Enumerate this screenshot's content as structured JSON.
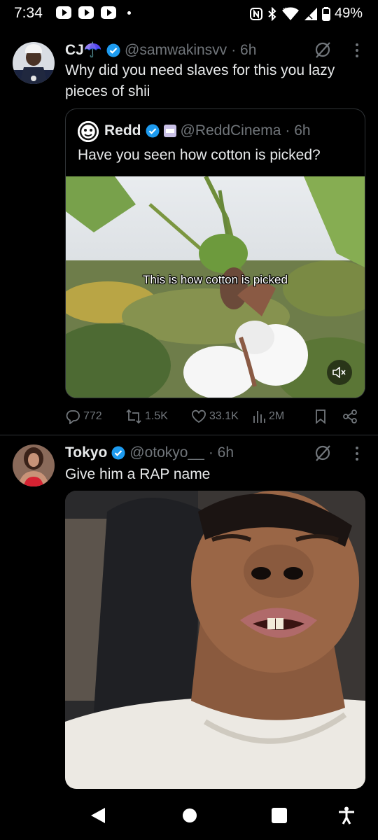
{
  "status_bar": {
    "time": "7:34",
    "battery": "49%",
    "notification_icons": [
      "youtube-icon",
      "youtube-icon",
      "youtube-icon"
    ],
    "system_icons": [
      "nfc-icon",
      "bluetooth-icon",
      "wifi-icon",
      "signal-icon",
      "battery-icon"
    ]
  },
  "tweets": [
    {
      "name": "CJ☂️",
      "handle": "@samwakinsvv",
      "time": "· 6h",
      "text": "Why did you need slaves for this you lazy pieces of shii",
      "quote": {
        "name": "Redd",
        "handle": "@ReddCinema",
        "time": "· 6h",
        "text": "Have you seen how cotton is picked?",
        "video_caption": "This is how cotton is picked"
      },
      "stats": {
        "replies": "772",
        "reposts": "1.5K",
        "likes": "33.1K",
        "views": "2M"
      }
    },
    {
      "name": "Tokyo",
      "handle": "@otokyo__",
      "time": "· 6h",
      "text": "Give him a RAP name"
    }
  ],
  "colors": {
    "background": "#000000",
    "text": "#e7e9ea",
    "muted": "#71767b",
    "verified": "#1d9bf0",
    "divider": "#2f3336"
  }
}
